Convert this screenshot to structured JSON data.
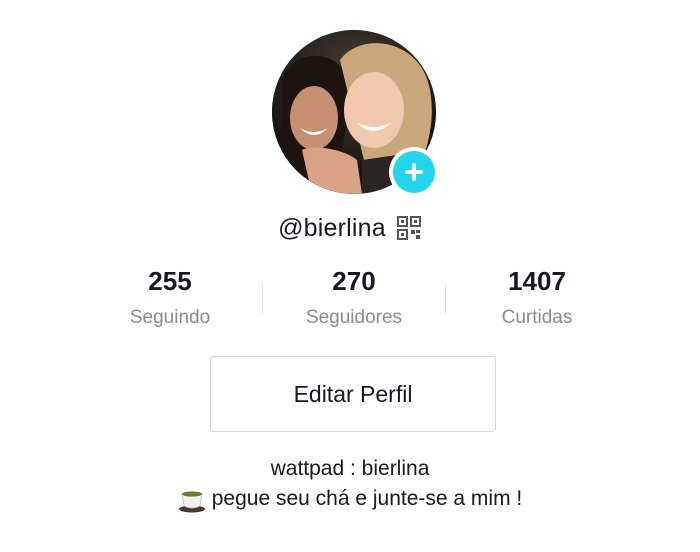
{
  "profile": {
    "username": "@bierlina",
    "avatar_alt": "profile photo",
    "add_icon": "plus-icon",
    "qr_icon": "qr-code-icon"
  },
  "stats": [
    {
      "value": "255",
      "label": "Seguindo"
    },
    {
      "value": "270",
      "label": "Seguidores"
    },
    {
      "value": "1407",
      "label": "Curtidas"
    }
  ],
  "edit_button": {
    "label": "Editar Perfil"
  },
  "bio": {
    "line1": "wattpad : bierlina",
    "line2": "pegue seu chá e junte-se a mim !",
    "line2_icon": "tea-cup-icon"
  },
  "colors": {
    "accent": "#20d5ec",
    "text": "#161823",
    "muted": "#8a8b91",
    "border": "#d6d6d8"
  }
}
